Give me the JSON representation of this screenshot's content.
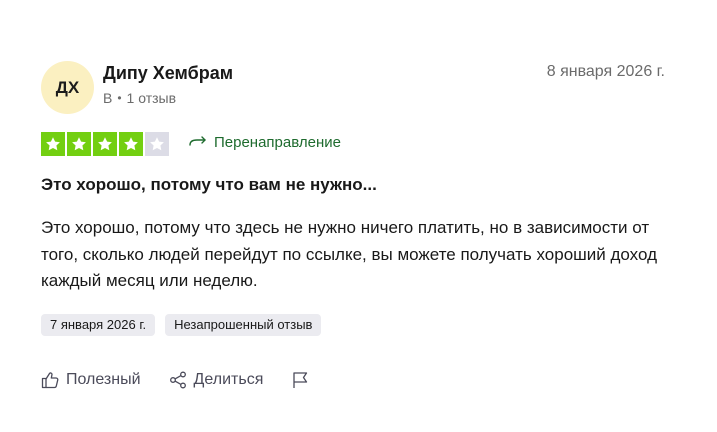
{
  "review": {
    "author": {
      "initials": "ДХ",
      "name": "Дипу Хембрам",
      "country": "В",
      "separator": "•",
      "review_count": "1 отзыв",
      "avatar_color": "#fbf0c1"
    },
    "date": "8 января 2026 г.",
    "rating": {
      "value": 4,
      "max": 5,
      "star_color": "#73cf11",
      "empty_color": "#dcdce6"
    },
    "redirect_label": "Перенаправление",
    "title": "Это хорошо, потому что вам не нужно...",
    "body": "Это хорошо, потому что здесь не нужно ничего платить, но в зависимости от того, сколько людей перейдут по ссылке, вы можете получать хороший доход каждый месяц или неделю.",
    "tags": [
      "7 января 2026 г.",
      "Незапрошенный отзыв"
    ],
    "actions": {
      "helpful": "Полезный",
      "share": "Делиться"
    },
    "icons": {
      "redirect": "arrow-redirect-icon",
      "helpful": "thumbs-up-icon",
      "share": "share-icon",
      "flag": "flag-icon",
      "star": "star-icon"
    }
  }
}
